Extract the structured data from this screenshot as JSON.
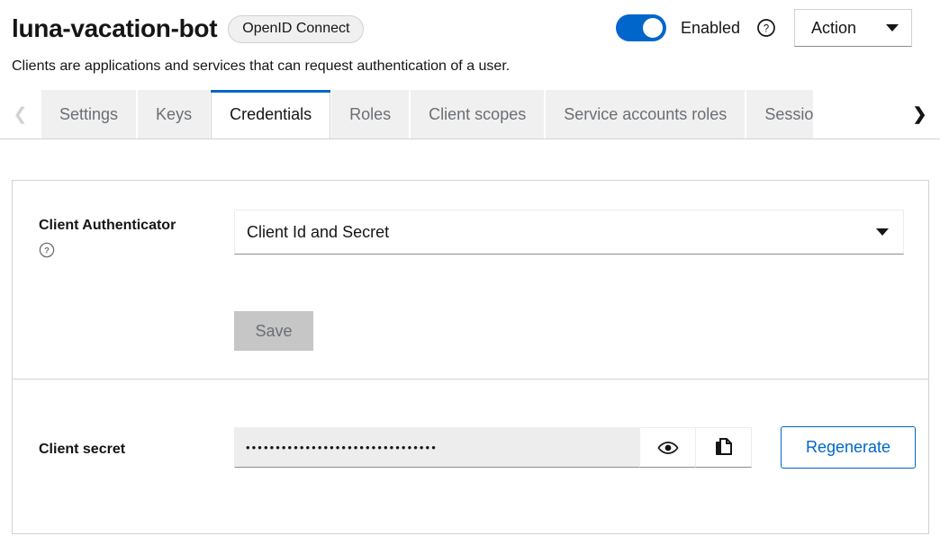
{
  "header": {
    "client_title": "luna-vacation-bot",
    "protocol_badge": "OpenID Connect",
    "description": "Clients are applications and services that can request authentication of a user.",
    "enabled_label": "Enabled",
    "enabled_state": true,
    "help_icon": "question-circle-icon",
    "action_button": "Action",
    "accent_color": "#0066cc"
  },
  "tabs": {
    "scroll_left_icon": "chevron-left-icon",
    "scroll_right_icon": "chevron-right-icon",
    "items": [
      {
        "label": "Settings",
        "active": false
      },
      {
        "label": "Keys",
        "active": false
      },
      {
        "label": "Credentials",
        "active": true
      },
      {
        "label": "Roles",
        "active": false
      },
      {
        "label": "Client scopes",
        "active": false
      },
      {
        "label": "Service accounts roles",
        "active": false
      },
      {
        "label": "Sessio",
        "active": false
      }
    ]
  },
  "authenticator_section": {
    "label": "Client Authenticator",
    "help_icon": "question-circle-icon",
    "selected_value": "Client Id and Secret",
    "caret_icon": "caret-down-icon",
    "save_label": "Save",
    "save_disabled": true
  },
  "secret_section": {
    "label": "Client secret",
    "masked_value": "••••••••••••••••••••••••••••••••",
    "show_icon": "eye-icon",
    "copy_icon": "copy-icon",
    "regenerate_label": "Regenerate"
  }
}
